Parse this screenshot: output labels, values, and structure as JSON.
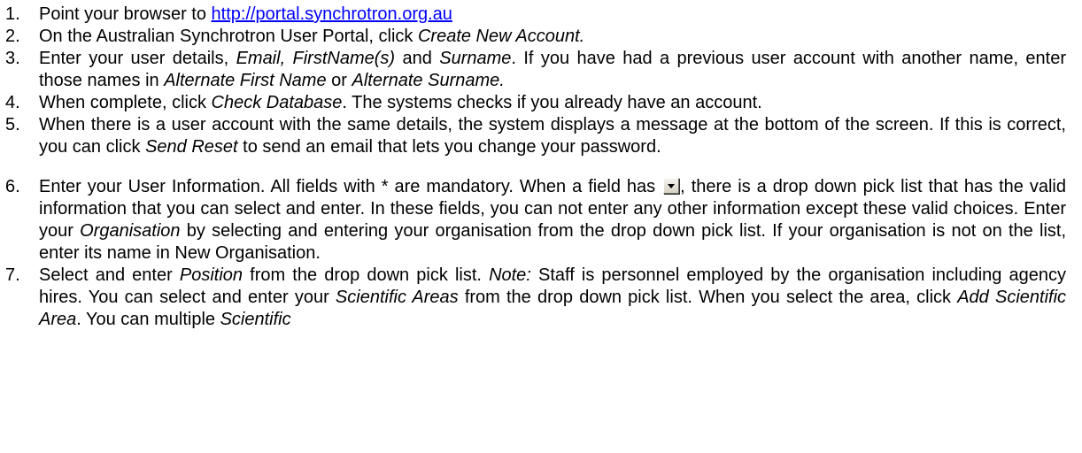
{
  "steps": [
    {
      "number": "1.",
      "segments": [
        {
          "t": "Point your browser to "
        },
        {
          "t": "http://portal.synchrotron.org.au",
          "link": true
        }
      ]
    },
    {
      "number": "2.",
      "segments": [
        {
          "t": "On the Australian Synchrotron User Portal, click "
        },
        {
          "t": "Create New Account.",
          "em": true
        }
      ]
    },
    {
      "number": "3.",
      "segments": [
        {
          "t": "Enter your user details, "
        },
        {
          "t": "Email, FirstName(s)",
          "em": true
        },
        {
          "t": " and "
        },
        {
          "t": "Surname",
          "em": true
        },
        {
          "t": ". If you have had a previous user account with another name, enter those names in "
        },
        {
          "t": "Alternate First Name",
          "em": true
        },
        {
          "t": " or "
        },
        {
          "t": "Alternate Surname.",
          "em": true
        }
      ]
    },
    {
      "number": "4.",
      "segments": [
        {
          "t": "When complete, click "
        },
        {
          "t": "Check Database",
          "em": true
        },
        {
          "t": ". The systems checks if you already have an account."
        }
      ]
    },
    {
      "number": "5.",
      "segments": [
        {
          "t": "When there is a user account with the same details, the system displays a message at the bottom of the screen. If this is correct, you can click "
        },
        {
          "t": "Send Reset",
          "em": true
        },
        {
          "t": " to send an email that lets you change your password."
        }
      ]
    },
    {
      "number": "6.",
      "gap_before": true,
      "segments": [
        {
          "t": "Enter your User Information. All fields with * are mandatory. When a field has "
        },
        {
          "icon": "dropdown-arrow-icon"
        },
        {
          "t": ", there is a drop down pick list that has the valid information that you can select and enter. In these fields, you can not enter any other information except these valid choices. Enter your "
        },
        {
          "t": "Organisation",
          "em": true
        },
        {
          "t": " by selecting and entering your organisation from the drop down pick list. If your organisation is not on the list, enter its name in New Organisation."
        }
      ]
    },
    {
      "number": "7.",
      "segments": [
        {
          "t": "Select and enter "
        },
        {
          "t": "Position",
          "em": true
        },
        {
          "t": " from the drop down pick list. "
        },
        {
          "t": "Note:",
          "em": true
        },
        {
          "t": " Staff is personnel employed by the organisation including agency hires. You can select and enter your "
        },
        {
          "t": "Scientific Areas",
          "em": true
        },
        {
          "t": " from the drop down pick list. When you select the area, click "
        },
        {
          "t": "Add Scientific Area",
          "em": true
        },
        {
          "t": ". You can multiple "
        },
        {
          "t": "Scientific",
          "em": true
        }
      ]
    }
  ]
}
